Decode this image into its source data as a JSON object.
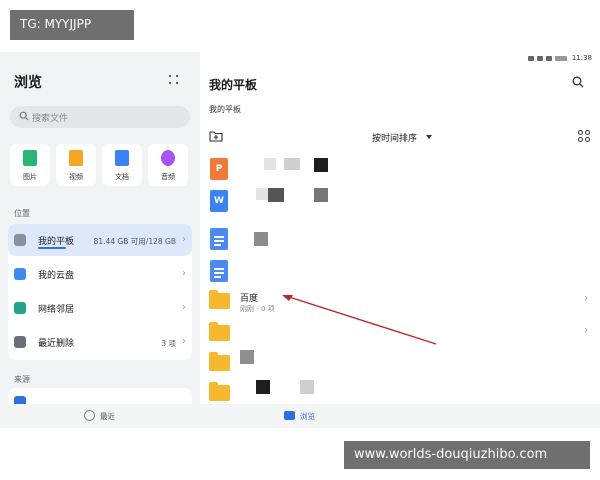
{
  "watermark_top": "TG: MYYJJPP",
  "watermark_bottom": "www.worlds-douqiuzhibo.com",
  "status_bar": {
    "time": "11:38",
    "battery": "86"
  },
  "sidebar": {
    "title": "浏览",
    "search_placeholder": "搜索文件",
    "categories": [
      {
        "label": "图片",
        "icon": "image-icon",
        "color": "#2bb673"
      },
      {
        "label": "视频",
        "icon": "video-icon",
        "color": "#f5a623"
      },
      {
        "label": "文档",
        "icon": "document-icon",
        "color": "#3b82f6"
      },
      {
        "label": "音频",
        "icon": "audio-icon",
        "color": "#a855f7"
      }
    ],
    "location_label": "位置",
    "locations": [
      {
        "name": "我的平板",
        "info": "81.44 GB 可用/128 GB",
        "icon": "tablet-icon",
        "active": true
      },
      {
        "name": "我的云盘",
        "info": "",
        "icon": "cloud-icon"
      },
      {
        "name": "网络邻居",
        "info": "",
        "icon": "network-icon"
      },
      {
        "name": "最近删除",
        "info": "3 项",
        "icon": "trash-icon"
      }
    ],
    "source_label": "来源"
  },
  "main": {
    "title": "我的平板",
    "breadcrumb": "我的平板",
    "sort_label": "按时间排序",
    "files": [
      {
        "type": "ppt",
        "glyph": "P",
        "color": "#f07a3a"
      },
      {
        "type": "word",
        "glyph": "W",
        "color": "#3b82f6"
      },
      {
        "type": "doc",
        "glyph": "",
        "color": "#4a8af4"
      },
      {
        "type": "doc",
        "glyph": "",
        "color": "#4a8af4"
      },
      {
        "type": "folder",
        "name": "百度",
        "meta": "刚刚 - 0 项"
      },
      {
        "type": "folder",
        "name": "",
        "meta": ""
      },
      {
        "type": "folder",
        "name": "",
        "meta": ""
      },
      {
        "type": "folder",
        "name": "",
        "meta": ""
      }
    ]
  },
  "bottom_nav": [
    {
      "label": "最近",
      "icon": "clock-icon",
      "active": false
    },
    {
      "label": "浏览",
      "icon": "folder-icon",
      "active": true
    }
  ],
  "colors": {
    "accent": "#2f6fe4",
    "folder": "#f5b82e",
    "arrow": "#b52a2a"
  }
}
